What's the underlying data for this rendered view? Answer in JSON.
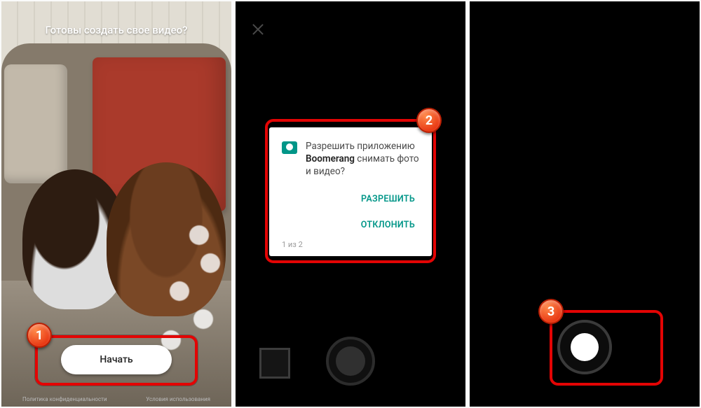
{
  "panel1": {
    "title": "Готовы создать свое видео?",
    "start_label": "Начать",
    "footer_left": "Политика конфиденциальности",
    "footer_right": "Условия использования",
    "marker": "1"
  },
  "panel2": {
    "marker": "2",
    "dialog": {
      "line1": "Разрешить приложению",
      "app_name": "Boomerang",
      "line2": " снимать фото и видео?",
      "allow_label": "РАЗРЕШИТЬ",
      "deny_label": "ОТКЛОНИТЬ",
      "progress": "1 из 2"
    }
  },
  "panel3": {
    "marker": "3"
  }
}
